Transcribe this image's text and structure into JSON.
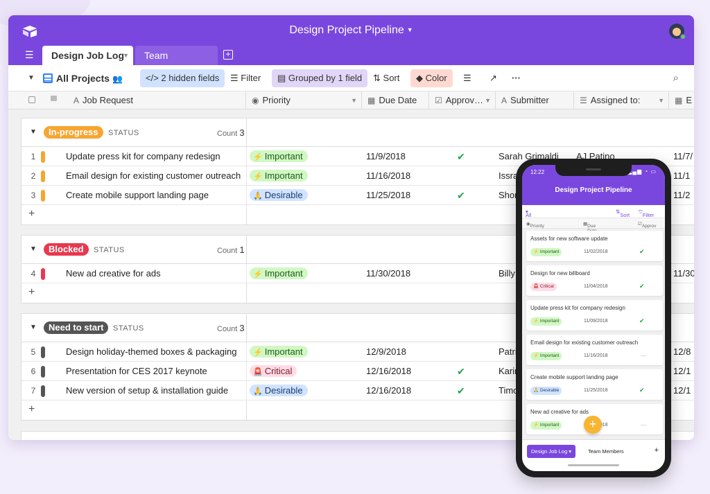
{
  "base": {
    "title": "Design Project Pipeline"
  },
  "tabs": [
    {
      "label": "Design Job Log"
    },
    {
      "label": "Team Members"
    }
  ],
  "toolbar": {
    "view_name": "All Projects",
    "hidden_fields": "2 hidden fields",
    "filter": "Filter",
    "grouped": "Grouped by 1 field",
    "sort": "Sort",
    "color": "Color"
  },
  "columns": {
    "job": "Job Request",
    "priority": "Priority",
    "due": "Due Date",
    "approved": "Approv…",
    "submitter": "Submitter",
    "assigned": "Assigned to:",
    "last": "E"
  },
  "status_word": "STATUS",
  "count_word": "Count",
  "groups": [
    {
      "name": "In-progress",
      "color": "#f7a531",
      "count": "3",
      "rows": [
        {
          "num": "1",
          "job": "Update press kit for company redesign",
          "priority": "Important",
          "due": "11/9/2018",
          "approved": true,
          "submitter": "Sarah Grimaldi",
          "assigned": "AJ Patino",
          "last": "11/7/"
        },
        {
          "num": "2",
          "job": "Email design for existing customer outreach",
          "priority": "Important",
          "due": "11/16/2018",
          "approved": false,
          "submitter": "Issra",
          "assigned": "",
          "last": "11/1"
        },
        {
          "num": "3",
          "job": "Create mobile support landing page",
          "priority": "Desirable",
          "due": "11/25/2018",
          "approved": true,
          "submitter": "Shor",
          "assigned": "",
          "last": "11/2"
        }
      ]
    },
    {
      "name": "Blocked",
      "color": "#e8384f",
      "count": "1",
      "rows": [
        {
          "num": "4",
          "job": "New ad creative for ads",
          "priority": "Important",
          "due": "11/30/2018",
          "approved": false,
          "submitter": "Billy",
          "assigned": "",
          "last": "11/30"
        }
      ]
    },
    {
      "name": "Need to start",
      "color": "#555555",
      "count": "3",
      "rows": [
        {
          "num": "5",
          "job": "Design holiday-themed boxes & packaging",
          "priority": "Important",
          "due": "12/9/2018",
          "approved": false,
          "submitter": "Patri",
          "assigned": "",
          "last": "12/8"
        },
        {
          "num": "6",
          "job": "Presentation for CES 2017 keynote",
          "priority": "Critical",
          "due": "12/16/2018",
          "approved": true,
          "submitter": "Karin",
          "assigned": "",
          "last": "12/1"
        },
        {
          "num": "7",
          "job": "New version of setup & installation guide",
          "priority": "Desirable",
          "due": "12/16/2018",
          "approved": true,
          "submitter": "Timo",
          "assigned": "",
          "last": "12/1"
        }
      ]
    }
  ],
  "phone": {
    "time": "12:22",
    "title": "Design Project Pipeline",
    "view": "All Projects",
    "sort": "Sort",
    "filter": "Filter",
    "col_priority": "Priority",
    "col_due": "Due Date",
    "col_approved": "Approv",
    "cards": [
      {
        "title": "Assets for new software update",
        "priority": "Important",
        "date": "11/02/2018",
        "approved": true
      },
      {
        "title": "Design for new billboard",
        "priority": "Critical",
        "date": "11/04/2018",
        "approved": true
      },
      {
        "title": "Update press kit for company redesign",
        "priority": "Important",
        "date": "11/09/2018",
        "approved": true
      },
      {
        "title": "Email design for existing customer outreach",
        "priority": "Important",
        "date": "11/16/2018",
        "approved": false
      },
      {
        "title": "Create mobile support landing page",
        "priority": "Desirable",
        "date": "11/25/2018",
        "approved": true
      },
      {
        "title": "New ad creative for ads",
        "priority": "Important",
        "date": "11/30/2018",
        "approved": false
      }
    ],
    "tab_active": "Design Job Log",
    "tab2": "Team Members"
  },
  "colors": {
    "accent": "#7a47de",
    "important": "#d1f7c4",
    "desirable": "#d0e3ff",
    "critical": "#ffdce5"
  },
  "icons": [
    "app-logo-icon",
    "hamburger-icon",
    "grid-view-icon",
    "hidden-fields-icon",
    "filter-icon",
    "group-icon",
    "sort-icon",
    "color-icon",
    "row-height-icon",
    "share-icon",
    "more-icon",
    "search-icon",
    "lightning-icon",
    "hands-icon",
    "siren-icon",
    "check-icon",
    "plus-icon"
  ]
}
